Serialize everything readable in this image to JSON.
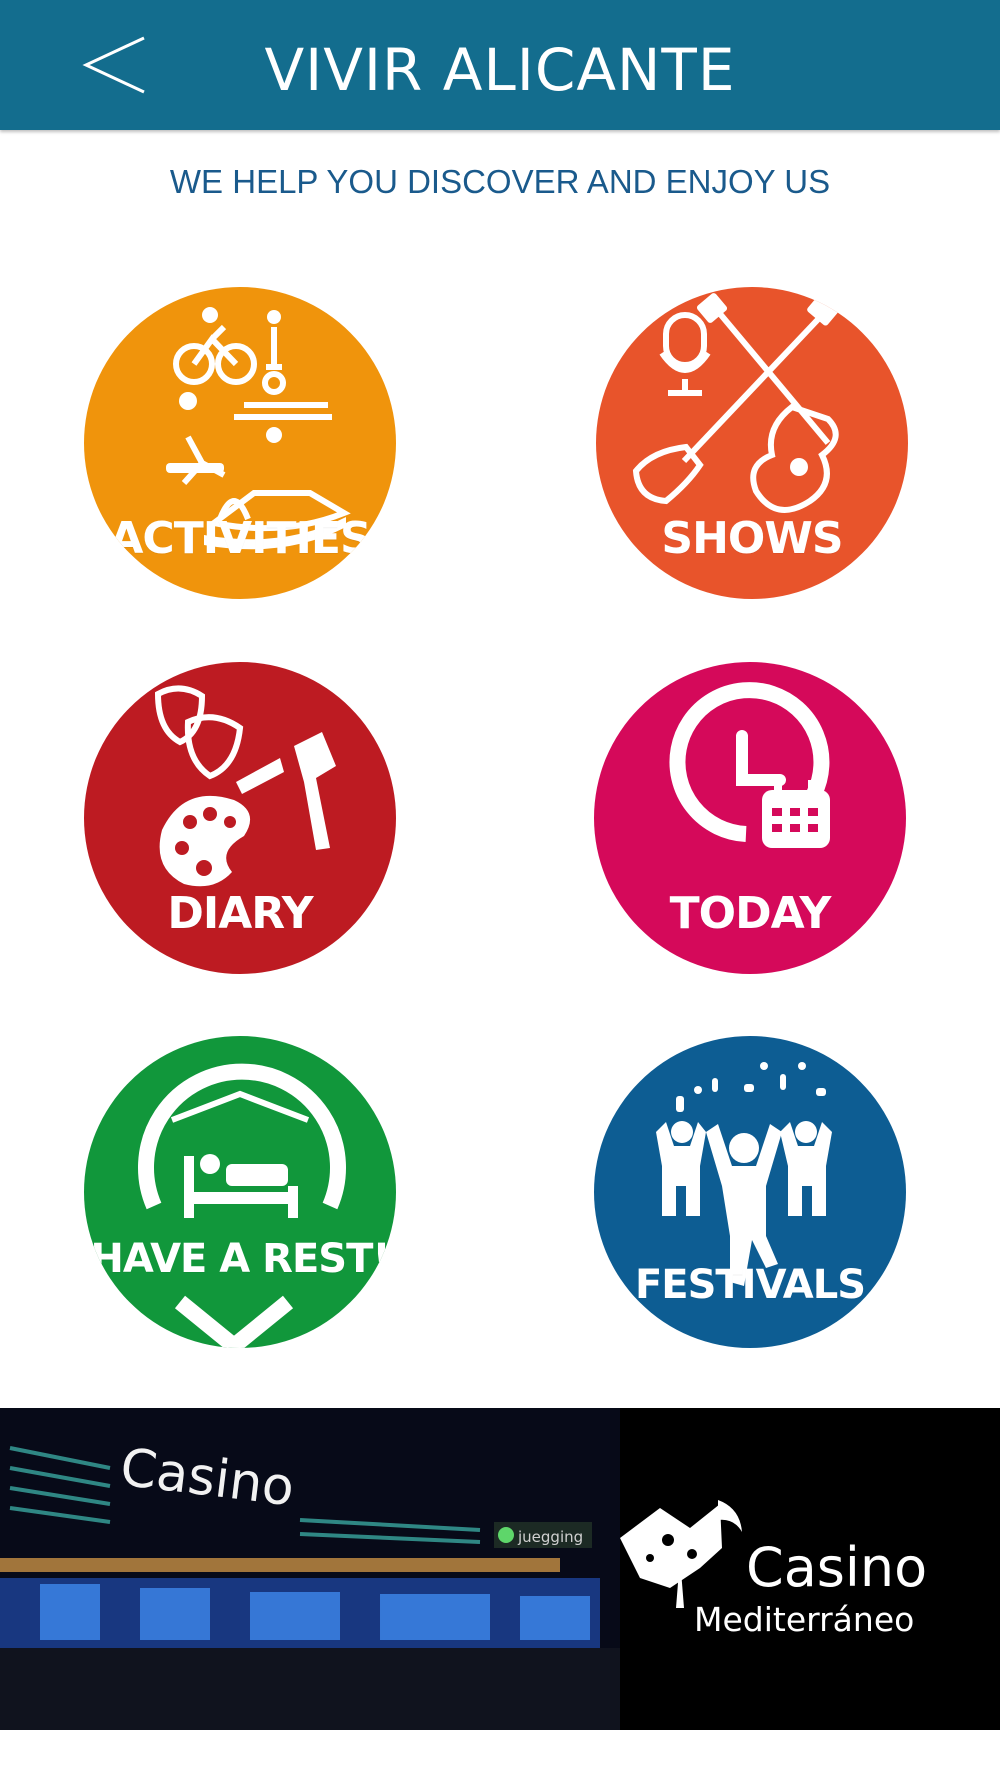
{
  "header": {
    "title": "VIVIR ALICANTE",
    "back_icon": "chevron-left-icon",
    "background": "#136d8e"
  },
  "tagline": "WE HELP YOU DISCOVER AND ENJOY US",
  "tiles": [
    {
      "label": "ACTIVITIES",
      "color": "#f0940c",
      "icon": "activities-icon"
    },
    {
      "label": "SHOWS",
      "color": "#e8542b",
      "icon": "guitar-microphone-icon"
    },
    {
      "label": "DIARY",
      "color": "#bd1b22",
      "icon": "theater-masks-palette-icon"
    },
    {
      "label": "TODAY",
      "color": "#d5095a",
      "icon": "clock-calendar-icon"
    },
    {
      "label": "HAVE A REST!",
      "color": "#11973b",
      "icon": "bed-location-pin-icon"
    },
    {
      "label": "FESTIVALS",
      "color": "#0d5d93",
      "icon": "crowd-celebration-icon"
    }
  ],
  "banner": {
    "building_sign": "Casino",
    "sub_sign": "juegging",
    "brand_line1": "Casino",
    "brand_line2": "Mediterráneo"
  }
}
